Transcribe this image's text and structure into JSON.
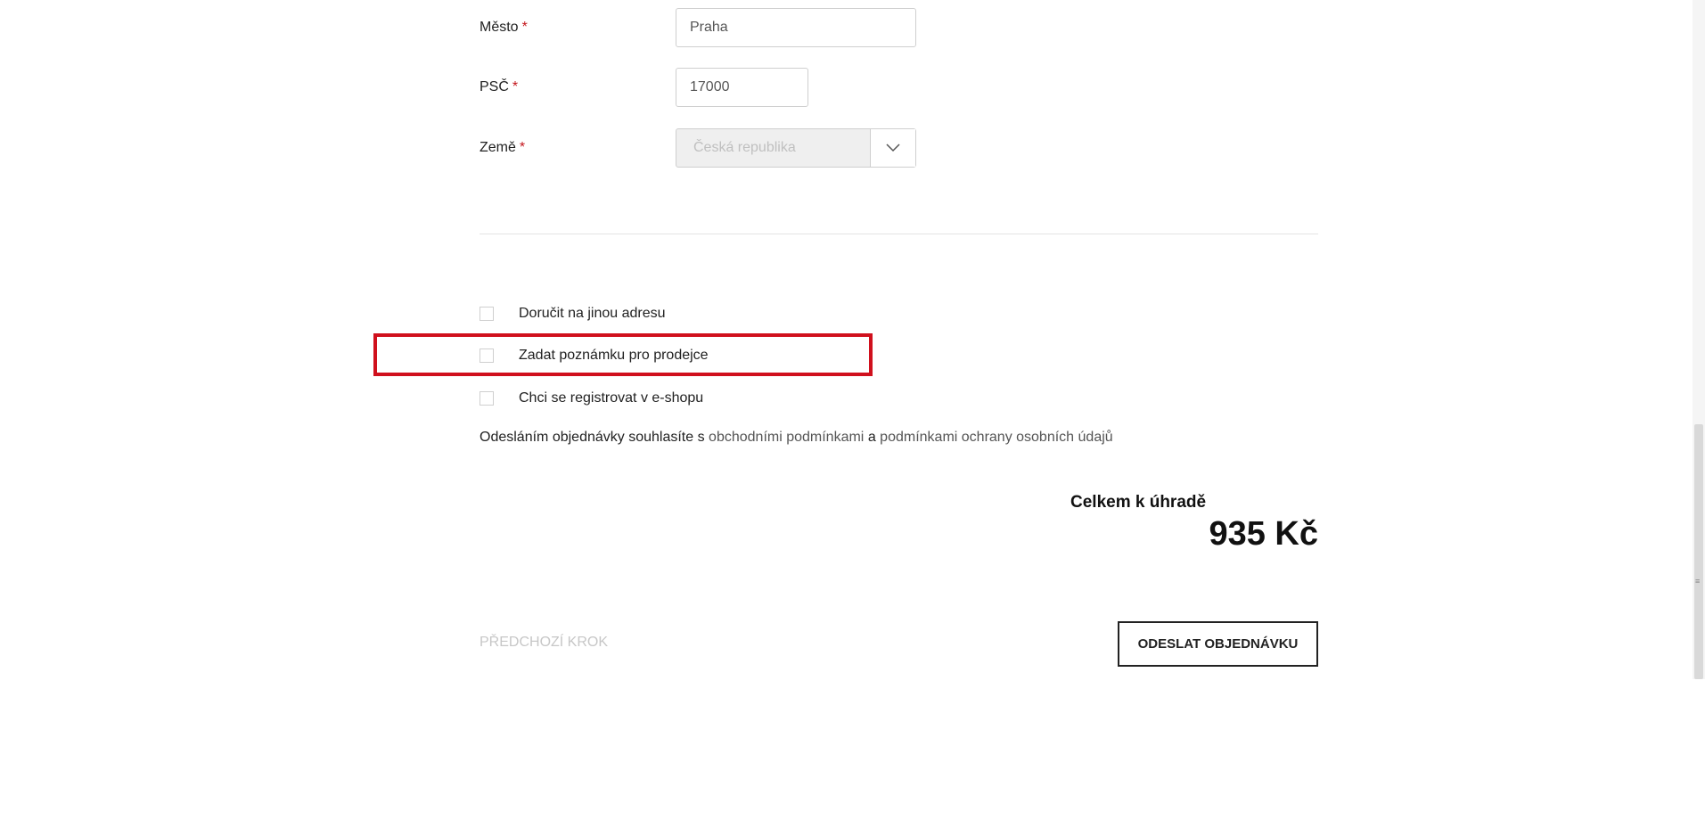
{
  "form": {
    "city": {
      "label": "Město",
      "required_mark": "*",
      "value": "Praha"
    },
    "zip": {
      "label": "PSČ",
      "required_mark": "*",
      "value": "17000"
    },
    "country": {
      "label": "Země",
      "required_mark": "*",
      "value": "Česká republika",
      "icon": "chevron-down-icon"
    }
  },
  "options": [
    {
      "label": "Doručit na jinou adresu",
      "checked": false
    },
    {
      "label": "Zadat poznámku pro prodejce",
      "checked": false,
      "highlighted": true
    },
    {
      "label": "Chci se registrovat v e-shopu",
      "checked": false
    }
  ],
  "consent": {
    "prefix": "Odesláním objednávky souhlasíte s",
    "terms_link": "obchodními podmínkami",
    "conjunction": "a",
    "privacy_link": "podmínkami ochrany osobních údajů"
  },
  "summary": {
    "total_label": "Celkem k úhradě",
    "total_value": "935 Kč"
  },
  "actions": {
    "prev_label": "Předchozí krok",
    "submit_label": "Odeslat objednávku"
  },
  "colors": {
    "required": "#c4161c",
    "highlight": "#d0101d"
  }
}
